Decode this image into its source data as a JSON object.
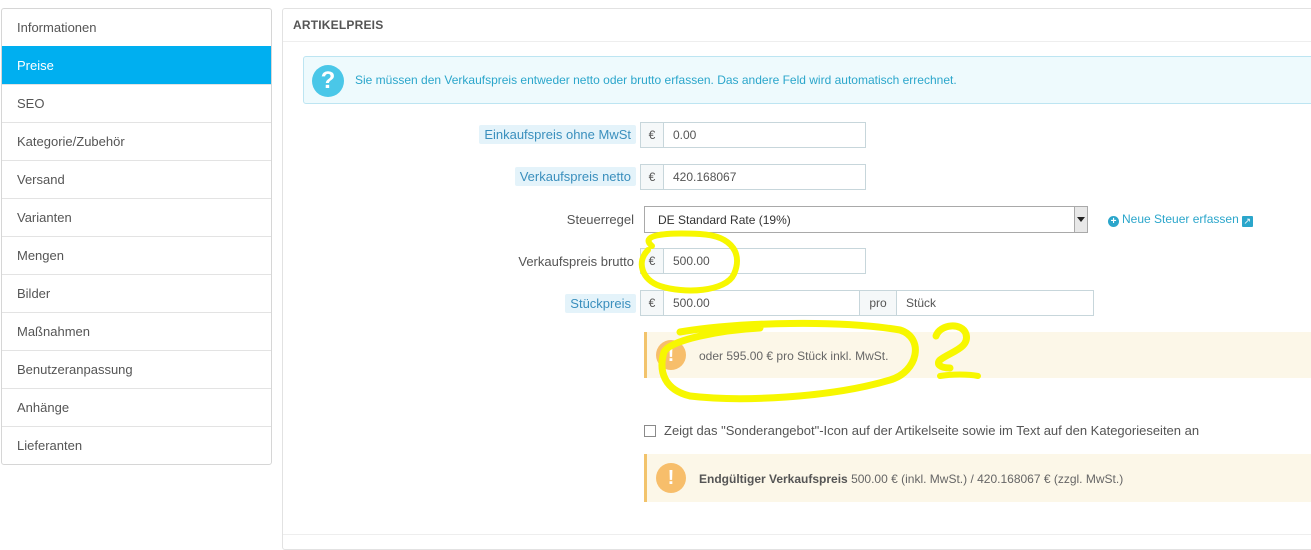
{
  "sidebar": {
    "items": [
      {
        "label": "Informationen"
      },
      {
        "label": "Preise"
      },
      {
        "label": "SEO"
      },
      {
        "label": "Kategorie/Zubehör"
      },
      {
        "label": "Versand"
      },
      {
        "label": "Varianten"
      },
      {
        "label": "Mengen"
      },
      {
        "label": "Bilder"
      },
      {
        "label": "Maßnahmen"
      },
      {
        "label": "Benutzeranpassung"
      },
      {
        "label": "Anhänge"
      },
      {
        "label": "Lieferanten"
      }
    ],
    "active_index": 1
  },
  "panel": {
    "title": "ARTIKELPREIS",
    "info_text": "Sie müssen den Verkaufspreis entweder netto oder brutto erfassen. Das andere Feld wird automatisch errechnet.",
    "info_icon_glyph": "?"
  },
  "form": {
    "currency_symbol": "€",
    "purchase_price": {
      "label": "Einkaufspreis ohne MwSt",
      "value": "0.00"
    },
    "net_price": {
      "label": "Verkaufspreis netto",
      "value": "420.168067"
    },
    "tax_rule": {
      "label": "Steuerregel",
      "selected": "DE Standard Rate (19%)",
      "new_tax_link": "Neue Steuer erfassen"
    },
    "gross_price": {
      "label": "Verkaufspreis brutto",
      "value": "500.00"
    },
    "unit_price": {
      "label": "Stückpreis",
      "value": "500.00",
      "per_label": "pro",
      "unit_value": "Stück"
    }
  },
  "unit_notice": {
    "text": "oder 595.00 € pro Stück inkl. MwSt.",
    "icon_glyph": "!"
  },
  "on_sale": {
    "label": "Zeigt das \"Sonderangebot\"-Icon auf der Artikelseite sowie im Text auf den Kategorieseiten an",
    "checked": false
  },
  "final_price": {
    "bold_label": "Endgültiger Verkaufspreis",
    "text": "500.00 € (inkl. MwSt.) / 420.168067 € (zzgl. MwSt.)",
    "icon_glyph": "!"
  },
  "colors": {
    "accent": "#00aff0",
    "link": "#2ba6cb",
    "warning": "#f7be6b",
    "annotation": "#f7f700"
  }
}
